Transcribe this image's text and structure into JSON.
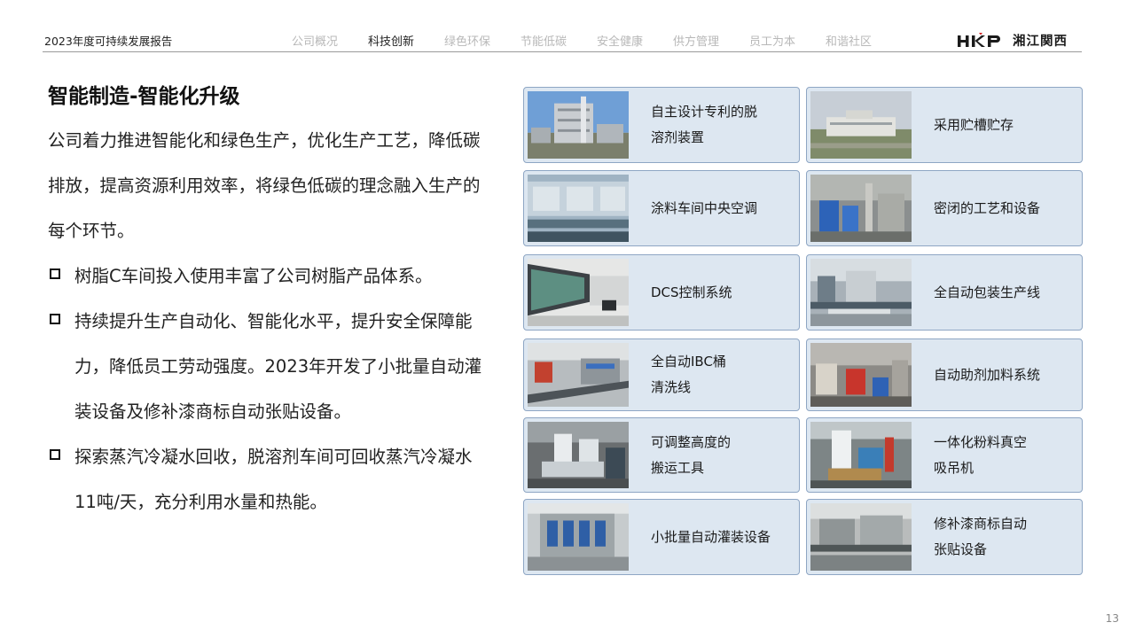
{
  "header": {
    "report_title": "2023年度可持续发展报告",
    "nav": [
      "公司概况",
      "科技创新",
      "绿色环保",
      "节能低碳",
      "安全健康",
      "供方管理",
      "员工为本",
      "和谐社区"
    ],
    "active_nav_index": 1,
    "logo_text": "湘江関西",
    "logo_mark": "HKP"
  },
  "main": {
    "title": "智能制造-智能化升级",
    "intro": "公司着力推进智能化和绿色生产，优化生产工艺，降低碳排放，提高资源利用效率，将绿色低碳的理念融入生产的每个环节。",
    "bullets": [
      "树脂C车间投入使用丰富了公司树脂产品体系。",
      "持续提升生产自动化、智能化水平，提升安全保障能力，降低员工劳动强度。2023年开发了小批量自动灌装设备及修补漆商标自动张贴设备。",
      "探索蒸汽冷凝水回收，脱溶剂车间可回收蒸汽冷凝水11吨/天，充分利用水量和热能。"
    ]
  },
  "cards": [
    {
      "label": "自主设计专利的脱\n溶剂装置",
      "photo": "factory-tower-photo"
    },
    {
      "label": "采用贮槽贮存",
      "photo": "storage-tank-photo"
    },
    {
      "label": "涂料车间中央空调",
      "photo": "air-conditioning-photo"
    },
    {
      "label": "密闭的工艺和设备",
      "photo": "sealed-equipment-photo"
    },
    {
      "label": "DCS控制系统",
      "photo": "control-room-photo"
    },
    {
      "label": "全自动包装生产线",
      "photo": "packaging-line-photo"
    },
    {
      "label": "全自动IBC桶\n清洗线",
      "photo": "ibc-washing-photo"
    },
    {
      "label": "自动助剂加料系统",
      "photo": "dosing-system-photo"
    },
    {
      "label": "可调整高度的\n搬运工具",
      "photo": "lifting-tool-photo"
    },
    {
      "label": "一体化粉料真空\n吸吊机",
      "photo": "vacuum-lifter-photo"
    },
    {
      "label": "小批量自动灌装设备",
      "photo": "filling-machine-photo"
    },
    {
      "label": "修补漆商标自动\n张贴设备",
      "photo": "labeling-machine-photo"
    }
  ],
  "page_number": "13"
}
